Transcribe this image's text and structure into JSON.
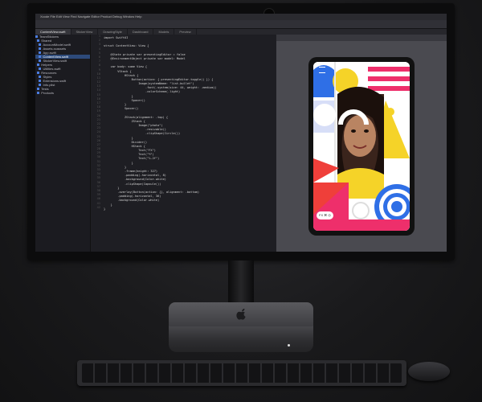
{
  "xcode": {
    "menubar": "Xcode  File  Edit  View  Find  Navigate  Editor  Product  Debug  Window  Help",
    "tabs": [
      "ContentView.swift",
      "StickerView",
      "DrawingStyle",
      "Dashboard",
      "Models",
      "Preview"
    ],
    "navigator": [
      "TeamStickers",
      "Shared",
      "AccountModel.swift",
      "Assets.xcassets",
      "App.swift",
      "ContentView.swift",
      "StickerView.swift",
      "Helpers",
      "Utilities.swift",
      "Resources",
      "Styles",
      "Extensions.swift",
      "Info.plist",
      "Tests",
      "Products"
    ],
    "code_lines": [
      "import SwiftUI",
      "",
      "struct ContentView: View {",
      "",
      "    @State private var presentingEditor = false",
      "    @EnvironmentObject private var model: Model",
      "",
      "    var body: some View {",
      "        VStack {",
      "            HStack {",
      "                Button(action: { presentingEditor.toggle() }) {",
      "                    Image(systemName: \"list.bullet\")",
      "                        .font(.system(size: 44, weight: .medium))",
      "                        .colorScheme(.light)",
      "                }",
      "                Spacer()",
      "            }",
      "            Spacer()",
      "",
      "            ZStack(alignment: .top) {",
      "                ZStack {",
      "                    Image(\"photo\")",
      "                        .resizable()",
      "                        .clipShape(Circle())",
      "                }",
      "                Divider()",
      "                HStack {",
      "                    Text(\"FX\")",
      "                    Text(\"Ч\")",
      "                    Text(\"%.2f\")",
      "                }",
      "            }",
      "            .frame(height: 327)",
      "            .padding(.horizontal, 8)",
      "            .background(Color.white)",
      "            .clipShape(Capsule())",
      "        }",
      "        .overlay(Button(action: {}, alignment: .bottom)",
      "        .padding(.horizontal, 36)",
      "        .background(Color.white)",
      "    }",
      "}"
    ],
    "device_controls": [
      "FX",
      "⌘",
      "◎"
    ]
  },
  "colors": {
    "accent_yellow": "#f5d328",
    "accent_pink": "#ee2f6b",
    "accent_blue": "#2f6fe6",
    "accent_red": "#ef3f3a"
  }
}
